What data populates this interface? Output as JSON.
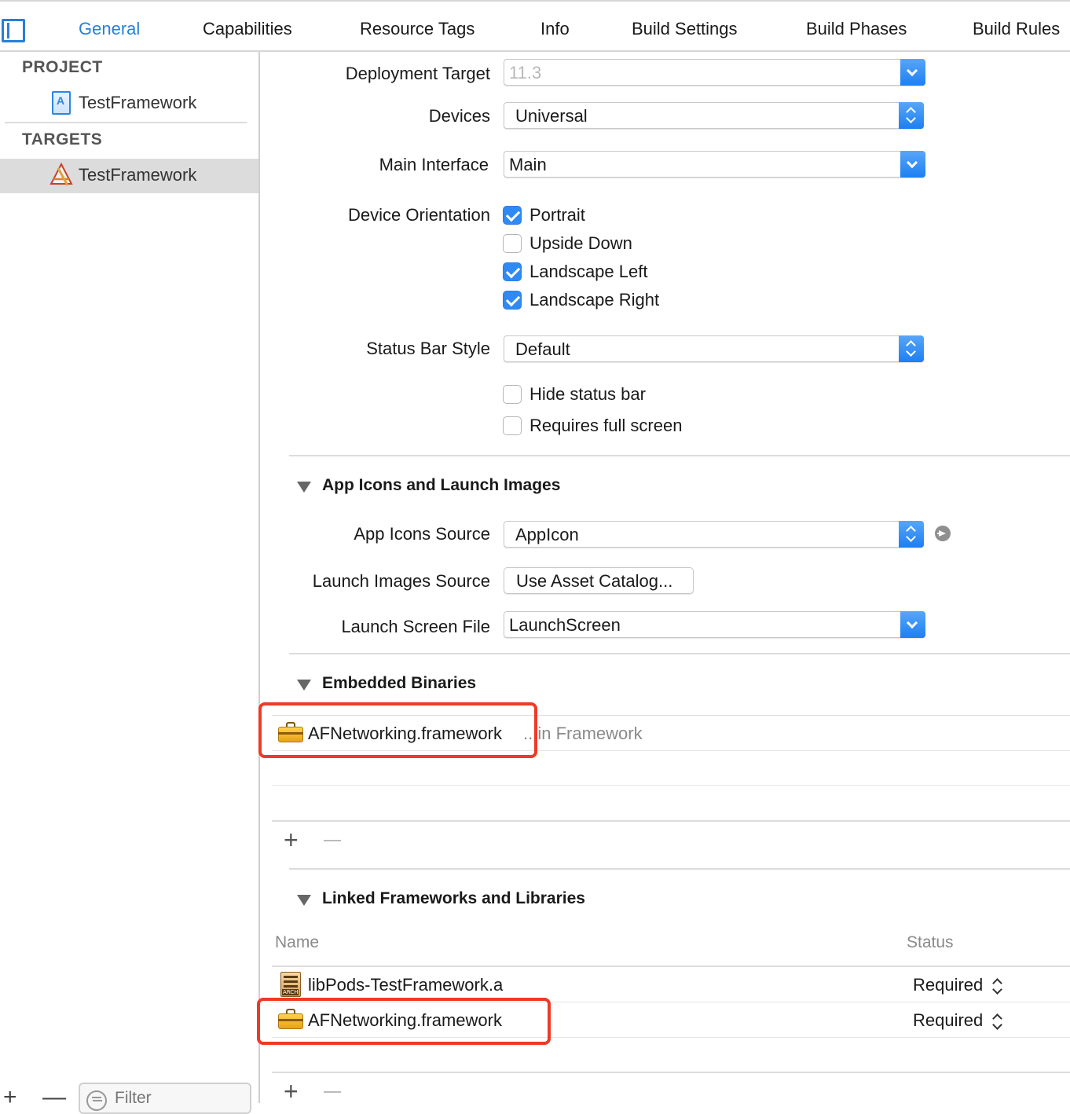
{
  "tabs": {
    "general": "General",
    "capabilities": "Capabilities",
    "resource_tags": "Resource Tags",
    "info": "Info",
    "build_settings": "Build Settings",
    "build_phases": "Build Phases",
    "build_rules": "Build Rules",
    "active": "General"
  },
  "sidebar": {
    "project_heading": "PROJECT",
    "project_item": "TestFramework",
    "targets_heading": "TARGETS",
    "target_item": "TestFramework",
    "filter_placeholder": "Filter"
  },
  "deployment": {
    "deployment_target_label": "Deployment Target",
    "deployment_target_value": "11.3",
    "devices_label": "Devices",
    "devices_value": "Universal",
    "main_interface_label": "Main Interface",
    "main_interface_value": "Main",
    "orientation_label": "Device Orientation",
    "orientations": [
      {
        "label": "Portrait",
        "checked": true
      },
      {
        "label": "Upside Down",
        "checked": false
      },
      {
        "label": "Landscape Left",
        "checked": true
      },
      {
        "label": "Landscape Right",
        "checked": true
      }
    ],
    "status_bar_style_label": "Status Bar Style",
    "status_bar_style_value": "Default",
    "hide_status_bar": {
      "label": "Hide status bar",
      "checked": false
    },
    "requires_full_screen": {
      "label": "Requires full screen",
      "checked": false
    }
  },
  "app_icons": {
    "section_title": "App Icons and Launch Images",
    "app_icons_source_label": "App Icons Source",
    "app_icons_source_value": "AppIcon",
    "launch_images_source_label": "Launch Images Source",
    "launch_images_button": "Use Asset Catalog...",
    "launch_screen_file_label": "Launch Screen File",
    "launch_screen_file_value": "LaunchScreen"
  },
  "embedded_binaries": {
    "section_title": "Embedded Binaries",
    "items": [
      {
        "name": "AFNetworking.framework",
        "location": "...in Framework"
      }
    ]
  },
  "linked_frameworks": {
    "section_title": "Linked Frameworks and Libraries",
    "col_name": "Name",
    "col_status": "Status",
    "items": [
      {
        "name": "libPods-TestFramework.a",
        "status": "Required"
      },
      {
        "name": "AFNetworking.framework",
        "status": "Required"
      }
    ]
  },
  "controls": {
    "add_symbol": "+",
    "remove_symbol": "—"
  },
  "colors": {
    "accent": "#2a7fd5",
    "highlight_box": "#ee3a26",
    "popup_button": "#1d7ff2"
  }
}
